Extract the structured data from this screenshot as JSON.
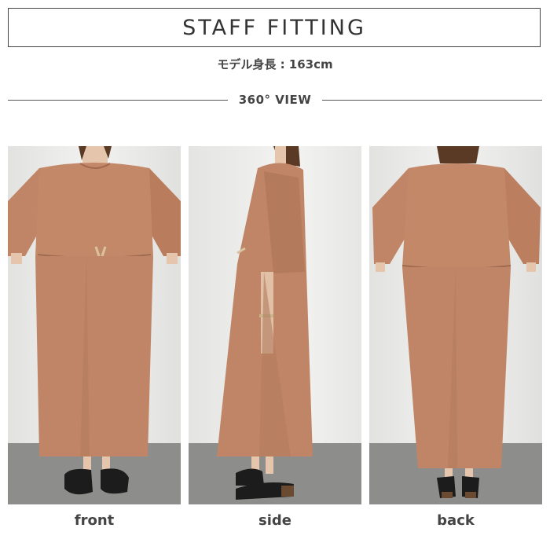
{
  "header": {
    "title": "STAFF FITTING",
    "model_height": "モデル身長 : 163cm",
    "view_label": "360° VIEW"
  },
  "photos": [
    {
      "caption": "front",
      "description_icon": "dress-front-photo"
    },
    {
      "caption": "side",
      "description_icon": "dress-side-photo"
    },
    {
      "caption": "back",
      "description_icon": "dress-back-photo"
    }
  ],
  "colors": {
    "dress": "#c08566",
    "dress_shadow": "#a86e53",
    "wall": "#ececea",
    "floor": "#8c8c8a",
    "skin": "#e8c8b0",
    "hair": "#5a3a24",
    "shoe": "#1c1c1c"
  }
}
